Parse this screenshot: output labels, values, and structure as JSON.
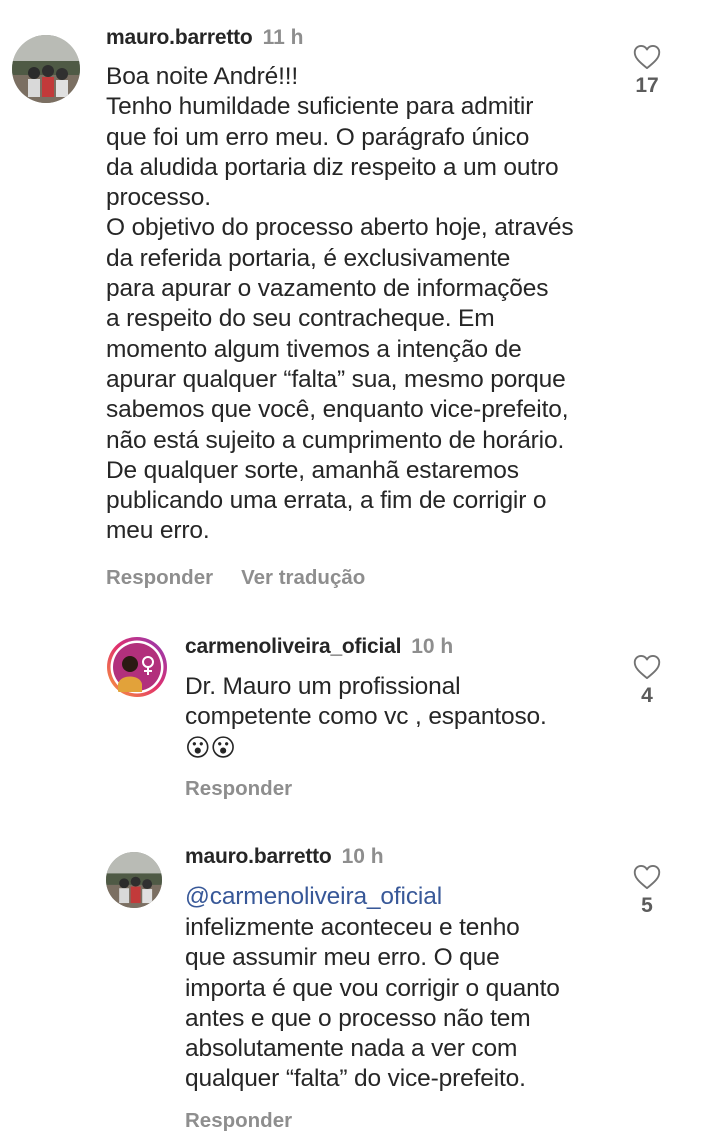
{
  "comments": [
    {
      "username": "mauro.barretto",
      "time": "11 h",
      "text": "Boa noite André!!!\nTenho humildade suficiente para admitir\nque foi um erro meu. O parágrafo único\nda aludida portaria diz respeito a um outro\nprocesso.\nO objetivo do processo aberto hoje, através\nda referida portaria, é exclusivamente\npara apurar o vazamento de informações\na respeito do seu contracheque.  Em\nmomento algum tivemos a intenção de\napurar qualquer “falta” sua, mesmo porque\nsabemos que você, enquanto vice-prefeito,\nnão está sujeito a cumprimento de horário.\nDe qualquer sorte, amanhã estaremos\npublicando uma errata, a fim de corrigir o\nmeu erro.",
      "reply_label": "Responder",
      "translate_label": "Ver tradução",
      "likes": "17"
    },
    {
      "username": "carmenoliveira_oficial",
      "time": "10 h",
      "text": "Dr. Mauro um profissional\ncompetente como vc , espantoso.",
      "emoji": "😮😮",
      "reply_label": "Responder",
      "likes": "4"
    },
    {
      "username": "mauro.barretto",
      "time": "10 h",
      "mention": "@carmenoliveira_oficial",
      "text": "infelizmente aconteceu e tenho\nque assumir meu erro. O que\nimporta é que vou corrigir o quanto\nantes e que o processo não tem\nabsolutamente nada a ver com\nqualquer “falta” do vice-prefeito.",
      "reply_label": "Responder",
      "likes": "5"
    }
  ],
  "colors": {
    "text": "#262626",
    "secondary": "#8e8e8e",
    "mention": "#385898",
    "story_ring": "#c13584"
  },
  "icons": {
    "like": "heart-outline-icon"
  }
}
